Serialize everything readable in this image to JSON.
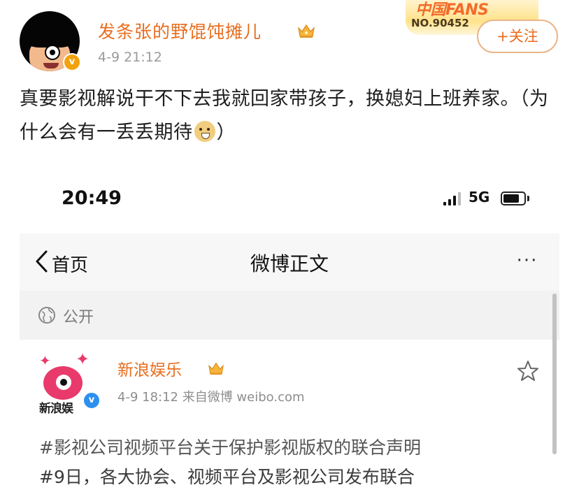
{
  "outer_post": {
    "username": "发条张的野馄饨摊儿",
    "timestamp": "4-9 21:12",
    "verified_badge": "v",
    "fans_badge": {
      "title": "中国FANS",
      "number": "NO.90452"
    },
    "follow_label": "+关注",
    "text_before_emoji": "真要影视解说干不下去我就回家带孩子，换媳妇上班养家。（为什么会有一丢丢期待",
    "text_after_emoji": "）",
    "emoji": "doge-icon"
  },
  "screenshot": {
    "status_bar": {
      "time": "20:49",
      "network": "5G",
      "battery_level": 0.8
    },
    "nav": {
      "back_label": "首页",
      "title": "微博正文",
      "more_label": "···"
    },
    "privacy": {
      "label": "公开"
    },
    "inner_post": {
      "username": "新浪娱乐",
      "avatar_text": "新浪娱",
      "verified_badge": "v",
      "meta": "4-9 18:12  来自微博 weibo.com",
      "line1": "#影视公司视频平台关于保护影视版权的联合声明",
      "line2": "#9日，各大协会、视频平台及影视公司发布联合"
    }
  },
  "colors": {
    "name_orange": "#e86d1f",
    "verified_gold": "#f2a20c",
    "verified_blue": "#2d8ff0",
    "nav_bg": "#f7f7f7"
  }
}
